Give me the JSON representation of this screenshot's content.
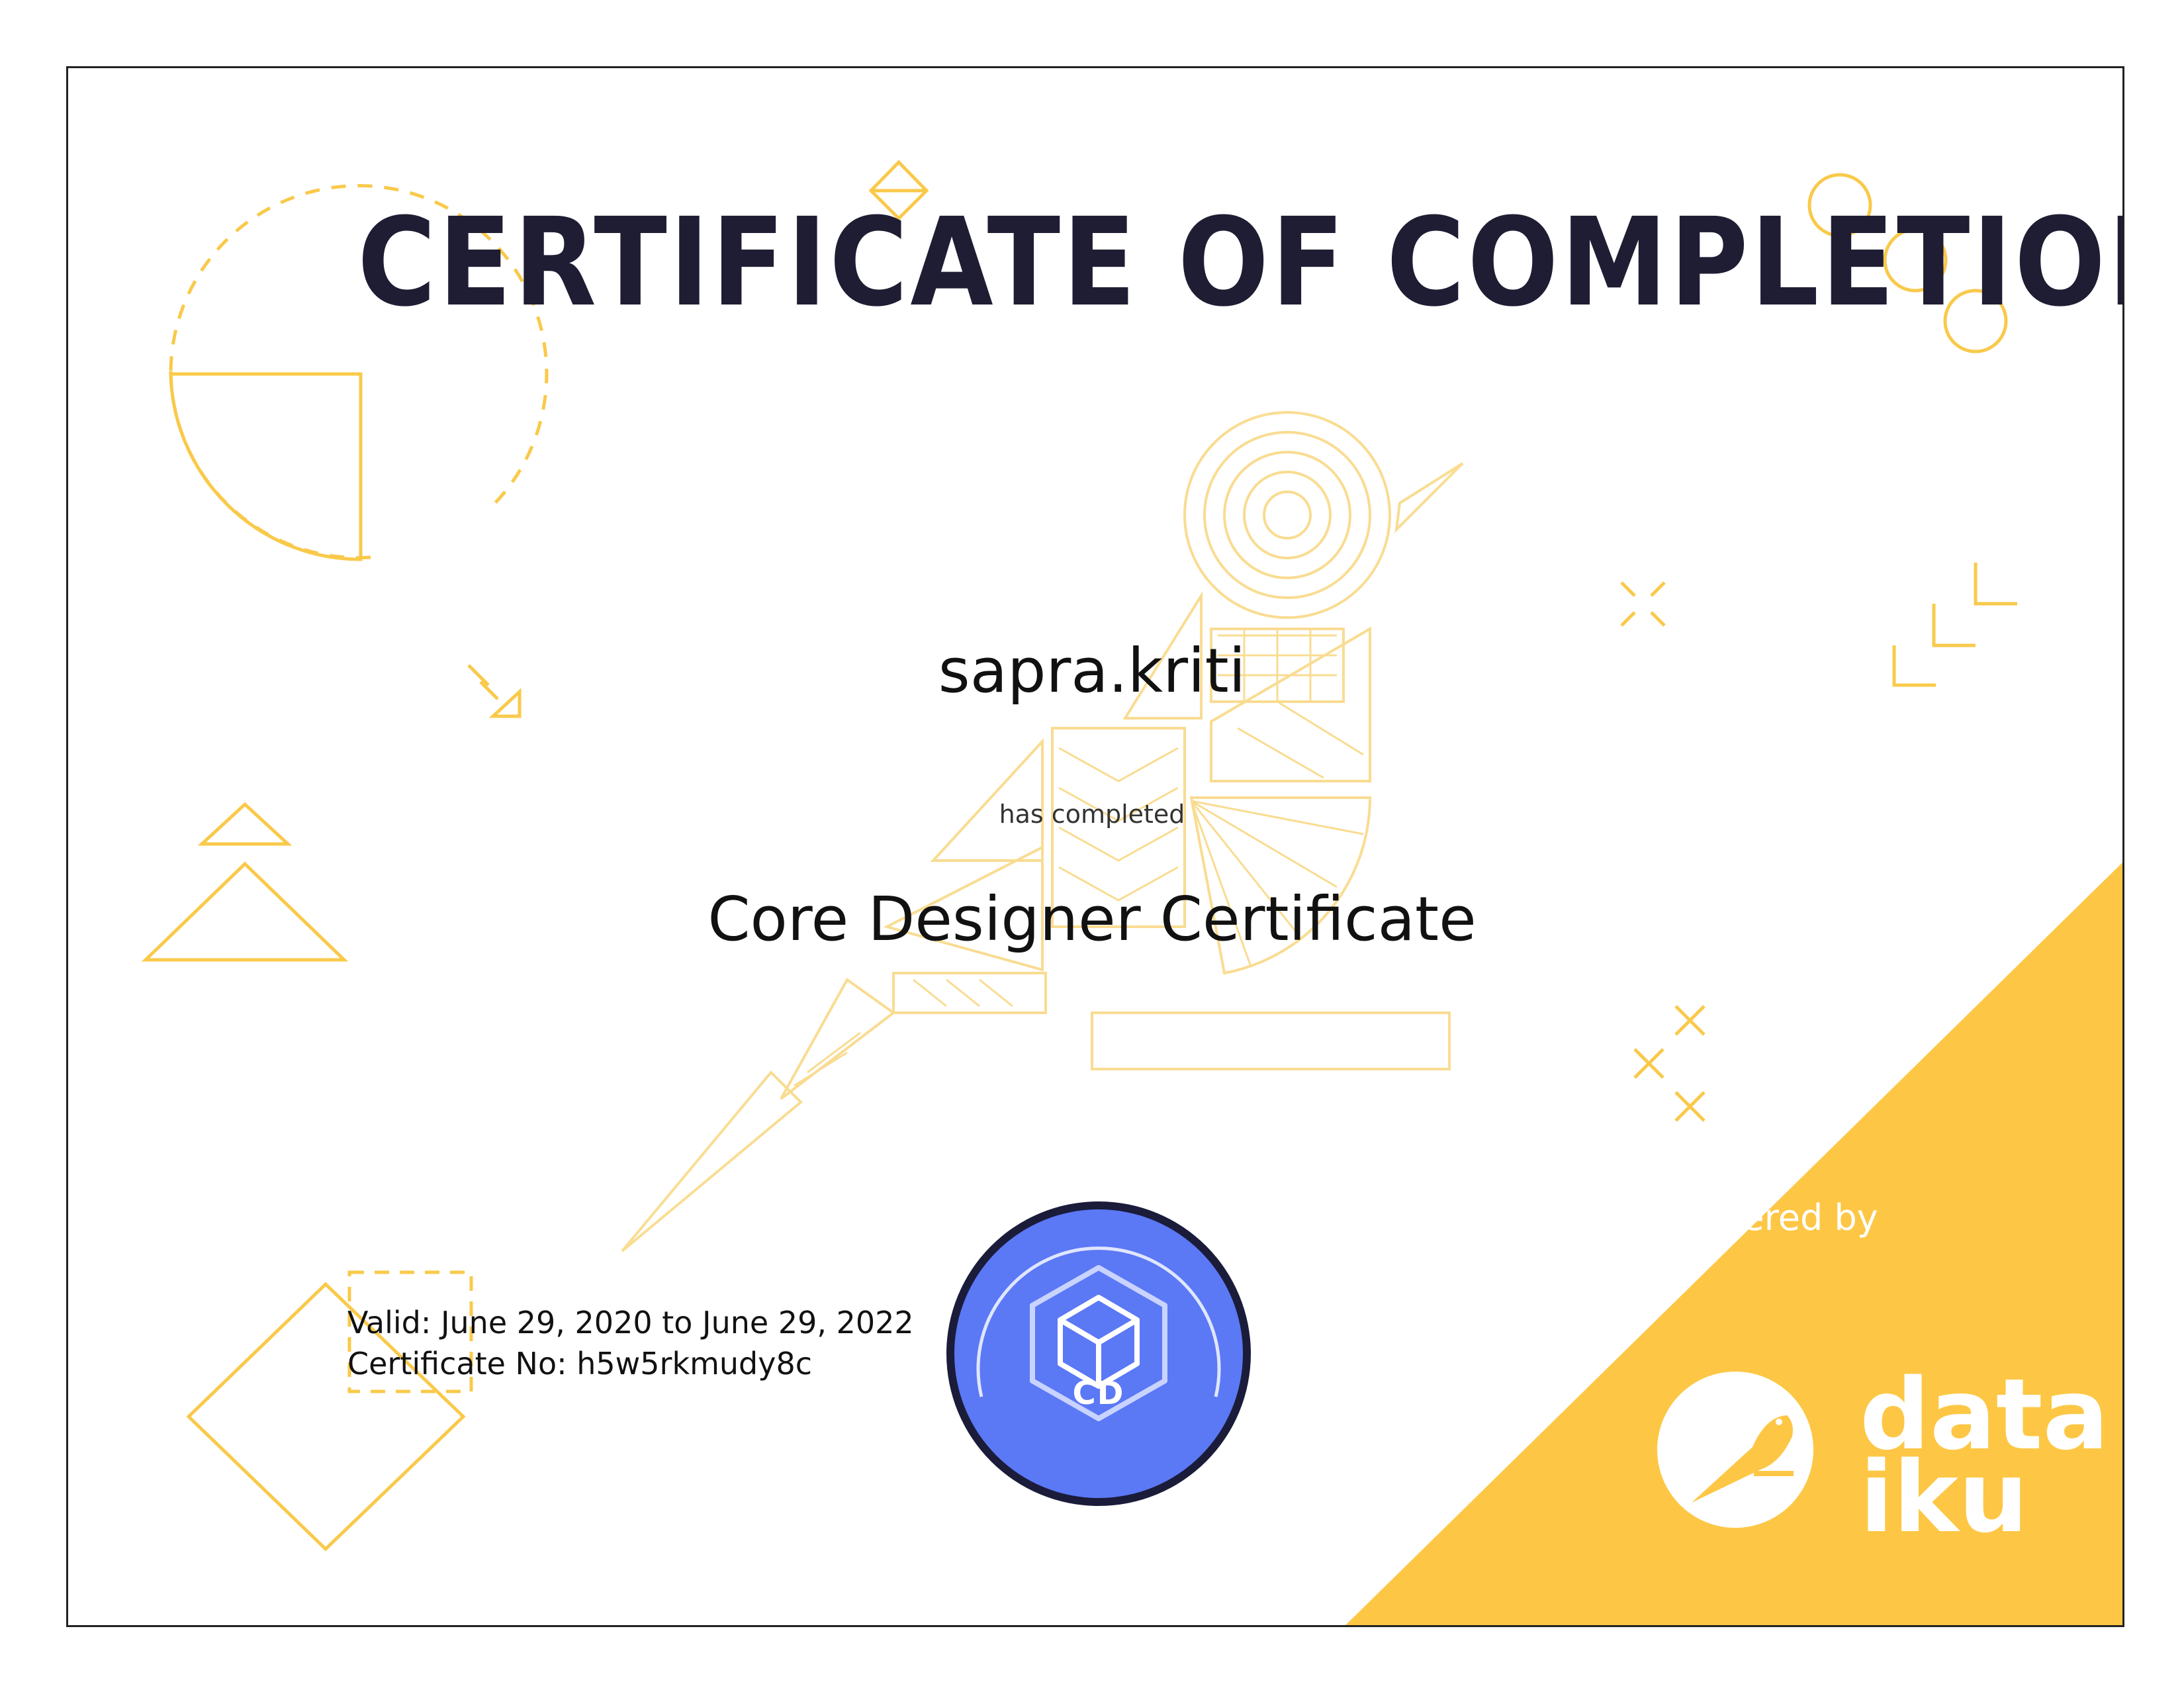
{
  "certificate": {
    "title": "CERTIFICATE OF COMPLETION",
    "recipient": "sapra.kriti",
    "completed_text": "has completed",
    "course_name": "Core Designer Certificate",
    "validity": "Valid: June 29, 2020 to June 29, 2022",
    "certificate_number": "Certificate No: h5w5rkmudy8c"
  },
  "badge": {
    "label": "CD",
    "icon": "cube-icon",
    "color": "#5b78f5"
  },
  "issuer": {
    "offered_by": "offered by",
    "logo_line1": "data",
    "logo_line2": "iku",
    "logo_icon": "bird-icon",
    "accent_color": "#fdc745"
  },
  "colors": {
    "title": "#1f1d33",
    "decoration": "#f9c94a",
    "frame": "#222222"
  }
}
